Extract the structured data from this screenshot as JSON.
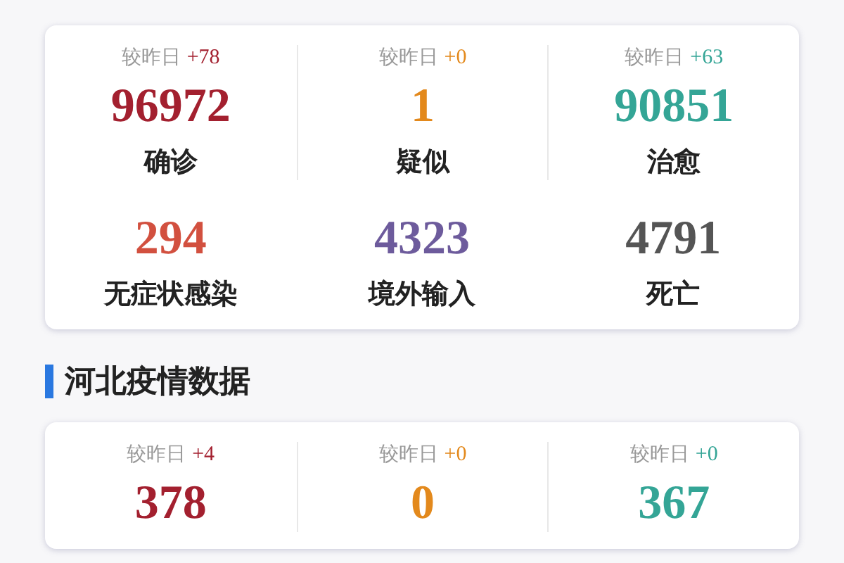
{
  "sections": [
    {
      "rows": [
        [
          {
            "delta_label": "较昨日",
            "delta": "+78",
            "value": "96972",
            "label": "确诊",
            "color": "#a3202f"
          },
          {
            "delta_label": "较昨日",
            "delta": "+0",
            "value": "1",
            "label": "疑似",
            "color": "#e3891c"
          },
          {
            "delta_label": "较昨日",
            "delta": "+63",
            "value": "90851",
            "label": "治愈",
            "color": "#34a596"
          }
        ],
        [
          {
            "value": "294",
            "label": "无症状感染",
            "color": "#d2503f"
          },
          {
            "value": "4323",
            "label": "境外输入",
            "color": "#6d5b9c"
          },
          {
            "value": "4791",
            "label": "死亡",
            "color": "#555555"
          }
        ]
      ]
    },
    {
      "title": "河北疫情数据",
      "rows": [
        [
          {
            "delta_label": "较昨日",
            "delta": "+4",
            "value": "378",
            "color": "#a3202f"
          },
          {
            "delta_label": "较昨日",
            "delta": "+0",
            "value": "0",
            "color": "#e3891c"
          },
          {
            "delta_label": "较昨日",
            "delta": "+0",
            "value": "367",
            "color": "#34a596"
          }
        ]
      ]
    }
  ]
}
